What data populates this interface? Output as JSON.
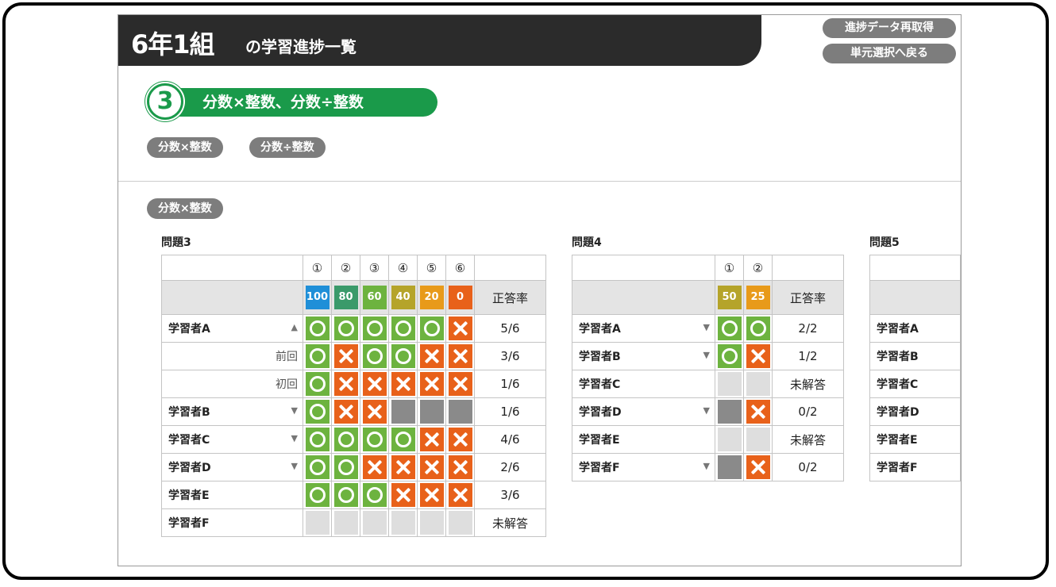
{
  "header": {
    "class_name": "6年1組",
    "subtitle": "の学習進捗一覧"
  },
  "buttons": {
    "refetch": "進捗データ再取得",
    "back": "単元選択へ戻る"
  },
  "unit": {
    "number": "3",
    "title": "分数×整数、分数÷整数"
  },
  "filter_chips": [
    "分数×整数",
    "分数÷整数"
  ],
  "section_chip": "分数×整数",
  "colors": {
    "green": "#1a9a4a",
    "correct": "#6db33f",
    "wrong": "#e8611a",
    "gray_chip": "#7d7d7d"
  },
  "problems": [
    {
      "title": "問題3",
      "questions": [
        "①",
        "②",
        "③",
        "④",
        "⑤",
        "⑥"
      ],
      "scores": [
        {
          "label": "100",
          "color": "#1f8fd8"
        },
        {
          "label": "80",
          "color": "#3a9a6a"
        },
        {
          "label": "60",
          "color": "#6db33f"
        },
        {
          "label": "40",
          "color": "#b5a42a"
        },
        {
          "label": "20",
          "color": "#e89a1a"
        },
        {
          "label": "0",
          "color": "#e8611a"
        }
      ],
      "rate_header": "正答率",
      "rows": [
        {
          "name": "学習者A",
          "arrow": "▲",
          "marks": [
            "o",
            "o",
            "o",
            "o",
            "o",
            "x"
          ],
          "rate": "5/6"
        },
        {
          "name": "前回",
          "sub": true,
          "marks": [
            "o",
            "x",
            "o",
            "o",
            "x",
            "x"
          ],
          "rate": "3/6"
        },
        {
          "name": "初回",
          "sub": true,
          "marks": [
            "o",
            "x",
            "x",
            "x",
            "x",
            "x"
          ],
          "rate": "1/6"
        },
        {
          "name": "学習者B",
          "arrow": "▼",
          "marks": [
            "o",
            "x",
            "x",
            "g",
            "g",
            "g"
          ],
          "rate": "1/6"
        },
        {
          "name": "学習者C",
          "arrow": "▼",
          "marks": [
            "o",
            "o",
            "o",
            "o",
            "x",
            "x"
          ],
          "rate": "4/6"
        },
        {
          "name": "学習者D",
          "arrow": "▼",
          "marks": [
            "o",
            "o",
            "x",
            "x",
            "x",
            "x"
          ],
          "rate": "2/6"
        },
        {
          "name": "学習者E",
          "marks": [
            "o",
            "o",
            "o",
            "x",
            "x",
            "x"
          ],
          "rate": "3/6"
        },
        {
          "name": "学習者F",
          "marks": [
            "e",
            "e",
            "e",
            "e",
            "e",
            "e"
          ],
          "rate": "未解答"
        }
      ]
    },
    {
      "title": "問題4",
      "questions": [
        "①",
        "②"
      ],
      "scores": [
        {
          "label": "50",
          "color": "#b5a42a"
        },
        {
          "label": "25",
          "color": "#e89a1a"
        }
      ],
      "rate_header": "正答率",
      "rows": [
        {
          "name": "学習者A",
          "arrow": "▼",
          "marks": [
            "o",
            "o"
          ],
          "rate": "2/2"
        },
        {
          "name": "学習者B",
          "arrow": "▼",
          "marks": [
            "o",
            "x"
          ],
          "rate": "1/2"
        },
        {
          "name": "学習者C",
          "marks": [
            "e",
            "e"
          ],
          "rate": "未解答"
        },
        {
          "name": "学習者D",
          "arrow": "▼",
          "marks": [
            "g",
            "x"
          ],
          "rate": "0/2"
        },
        {
          "name": "学習者E",
          "marks": [
            "e",
            "e"
          ],
          "rate": "未解答"
        },
        {
          "name": "学習者F",
          "arrow": "▼",
          "marks": [
            "g",
            "x"
          ],
          "rate": "0/2"
        }
      ]
    },
    {
      "title": "問題5",
      "questions": [],
      "scores": [],
      "rate_header": "",
      "rows": [
        {
          "name": "学習者A",
          "marks": []
        },
        {
          "name": "学習者B",
          "marks": []
        },
        {
          "name": "学習者C",
          "marks": []
        },
        {
          "name": "学習者D",
          "marks": []
        },
        {
          "name": "学習者E",
          "marks": []
        },
        {
          "name": "学習者F",
          "marks": []
        }
      ]
    }
  ]
}
